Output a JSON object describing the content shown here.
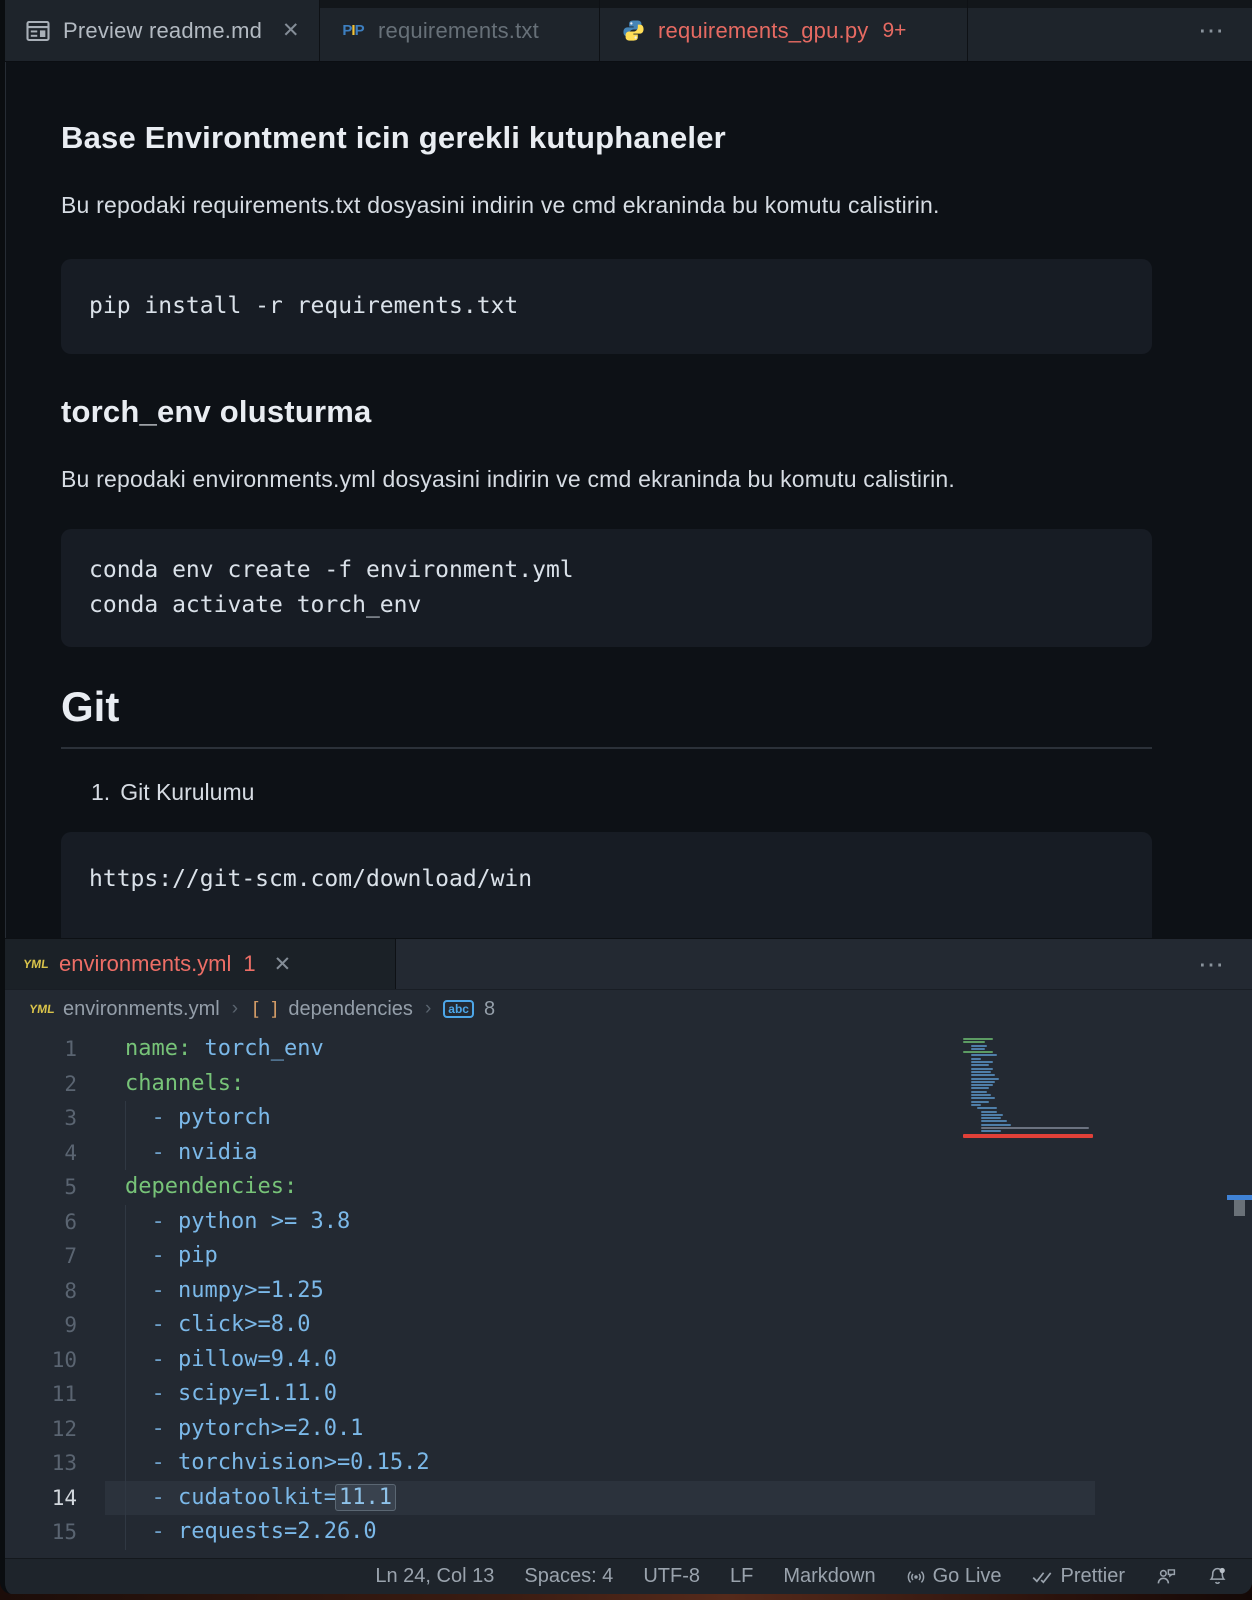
{
  "top_tabs": {
    "tabs": [
      {
        "label": "Preview readme.md",
        "icon": "markdown-preview",
        "close": "✕",
        "state": "active"
      },
      {
        "label": "requirements.txt",
        "icon": "pip",
        "state": "inactive"
      },
      {
        "label": "requirements_gpu.py",
        "badge": "9+",
        "icon": "python",
        "state": "inactive-error"
      }
    ],
    "overflow_menu": "⋯"
  },
  "preview": {
    "heading1": "Base Environtment icin gerekli kutuphaneler",
    "para1": "Bu repodaki requirements.txt dosyasini indirin ve cmd ekraninda bu komutu calistirin.",
    "code1": "pip install -r requirements.txt",
    "heading2": "torch_env olusturma",
    "para2": "Bu repodaki environments.yml dosyasini indirin ve cmd ekraninda bu komutu calistirin.",
    "code2": "conda env create -f environment.yml\nconda activate torch_env",
    "heading3": "Git",
    "list_num": "1.",
    "list_item": "Git Kurulumu",
    "code3": "https://git-scm.com/download/win"
  },
  "yml_pane": {
    "tab": {
      "label": "environments.yml",
      "problem_count": "1",
      "close": "✕",
      "icon": "yaml"
    },
    "overflow_menu": "⋯",
    "breadcrumb": {
      "file": "environments.yml",
      "sep": "›",
      "array_symbol": "[ ]",
      "node": "dependencies",
      "abc_label": "abc",
      "index": "8"
    }
  },
  "editor": {
    "language": "yaml",
    "lines": [
      {
        "n": "1",
        "guide": false,
        "current": false,
        "tokens": [
          [
            "k",
            "name:"
          ],
          [
            "v",
            " torch_env"
          ]
        ]
      },
      {
        "n": "2",
        "guide": false,
        "current": false,
        "tokens": [
          [
            "k",
            "channels:"
          ]
        ]
      },
      {
        "n": "3",
        "guide": true,
        "current": false,
        "tokens": [
          [
            "w",
            "  "
          ],
          [
            "d",
            "- "
          ],
          [
            "v",
            "pytorch"
          ]
        ]
      },
      {
        "n": "4",
        "guide": true,
        "current": false,
        "tokens": [
          [
            "w",
            "  "
          ],
          [
            "d",
            "- "
          ],
          [
            "v",
            "nvidia"
          ]
        ]
      },
      {
        "n": "5",
        "guide": false,
        "current": false,
        "tokens": [
          [
            "k",
            "dependencies:"
          ]
        ]
      },
      {
        "n": "6",
        "guide": true,
        "current": false,
        "tokens": [
          [
            "w",
            "  "
          ],
          [
            "d",
            "- "
          ],
          [
            "v",
            "python >= 3.8"
          ]
        ]
      },
      {
        "n": "7",
        "guide": true,
        "current": false,
        "tokens": [
          [
            "w",
            "  "
          ],
          [
            "d",
            "- "
          ],
          [
            "v",
            "pip"
          ]
        ]
      },
      {
        "n": "8",
        "guide": true,
        "current": false,
        "tokens": [
          [
            "w",
            "  "
          ],
          [
            "d",
            "- "
          ],
          [
            "v",
            "numpy>=1.25"
          ]
        ]
      },
      {
        "n": "9",
        "guide": true,
        "current": false,
        "tokens": [
          [
            "w",
            "  "
          ],
          [
            "d",
            "- "
          ],
          [
            "v",
            "click>=8.0"
          ]
        ]
      },
      {
        "n": "10",
        "guide": true,
        "current": false,
        "tokens": [
          [
            "w",
            "  "
          ],
          [
            "d",
            "- "
          ],
          [
            "v",
            "pillow=9.4.0"
          ]
        ]
      },
      {
        "n": "11",
        "guide": true,
        "current": false,
        "tokens": [
          [
            "w",
            "  "
          ],
          [
            "d",
            "- "
          ],
          [
            "v",
            "scipy=1.11.0"
          ]
        ]
      },
      {
        "n": "12",
        "guide": true,
        "current": false,
        "tokens": [
          [
            "w",
            "  "
          ],
          [
            "d",
            "- "
          ],
          [
            "v",
            "pytorch>=2.0.1"
          ]
        ]
      },
      {
        "n": "13",
        "guide": true,
        "current": false,
        "tokens": [
          [
            "w",
            "  "
          ],
          [
            "d",
            "- "
          ],
          [
            "v",
            "torchvision>=0.15.2"
          ]
        ]
      },
      {
        "n": "14",
        "guide": true,
        "current": true,
        "tokens": [
          [
            "w",
            "  "
          ],
          [
            "d",
            "- "
          ],
          [
            "v",
            "cudatoolkit="
          ],
          [
            "sel",
            "11.1"
          ]
        ]
      },
      {
        "n": "15",
        "guide": true,
        "current": false,
        "tokens": [
          [
            "w",
            "  "
          ],
          [
            "d",
            "- "
          ],
          [
            "v",
            "requests=2.26.0"
          ]
        ]
      }
    ]
  },
  "minimap": {
    "rows": [
      [
        "g",
        30,
        0
      ],
      [
        "g",
        22,
        0
      ],
      [
        "b",
        16,
        8
      ],
      [
        "b",
        14,
        8
      ],
      [
        "g",
        30,
        0
      ],
      [
        "b",
        26,
        8
      ],
      [
        "b",
        10,
        8
      ],
      [
        "b",
        22,
        8
      ],
      [
        "b",
        18,
        8
      ],
      [
        "b",
        22,
        8
      ],
      [
        "b",
        20,
        8
      ],
      [
        "b",
        24,
        8
      ],
      [
        "b",
        28,
        8
      ],
      [
        "b",
        24,
        8
      ],
      [
        "b",
        22,
        8
      ],
      [
        "b",
        18,
        8
      ],
      [
        "b",
        16,
        8
      ],
      [
        "b",
        20,
        8
      ],
      [
        "b",
        24,
        8
      ],
      [
        "b",
        18,
        8
      ],
      [
        "b",
        10,
        8
      ],
      [
        "b",
        20,
        14
      ],
      [
        "b",
        16,
        18
      ],
      [
        "b",
        22,
        18
      ],
      [
        "b",
        20,
        18
      ],
      [
        "b",
        26,
        18
      ],
      [
        "b",
        30,
        18
      ],
      [
        "gray",
        108,
        18
      ],
      [
        "b",
        20,
        18
      ],
      [
        "red",
        130,
        0
      ]
    ]
  },
  "status_bar": {
    "cursor": "Ln 24, Col 13",
    "indentation": "Spaces: 4",
    "encoding": "UTF-8",
    "eol": "LF",
    "language_mode": "Markdown",
    "go_live": "Go Live",
    "prettier": "Prettier"
  },
  "colors": {
    "error_tab": "#e66a62",
    "yaml_key": "#77c378",
    "yaml_value": "#7bb8e8",
    "minimap_error_line": "#e04038",
    "python_blue": "#4584b6",
    "python_yellow": "#ffde57"
  }
}
